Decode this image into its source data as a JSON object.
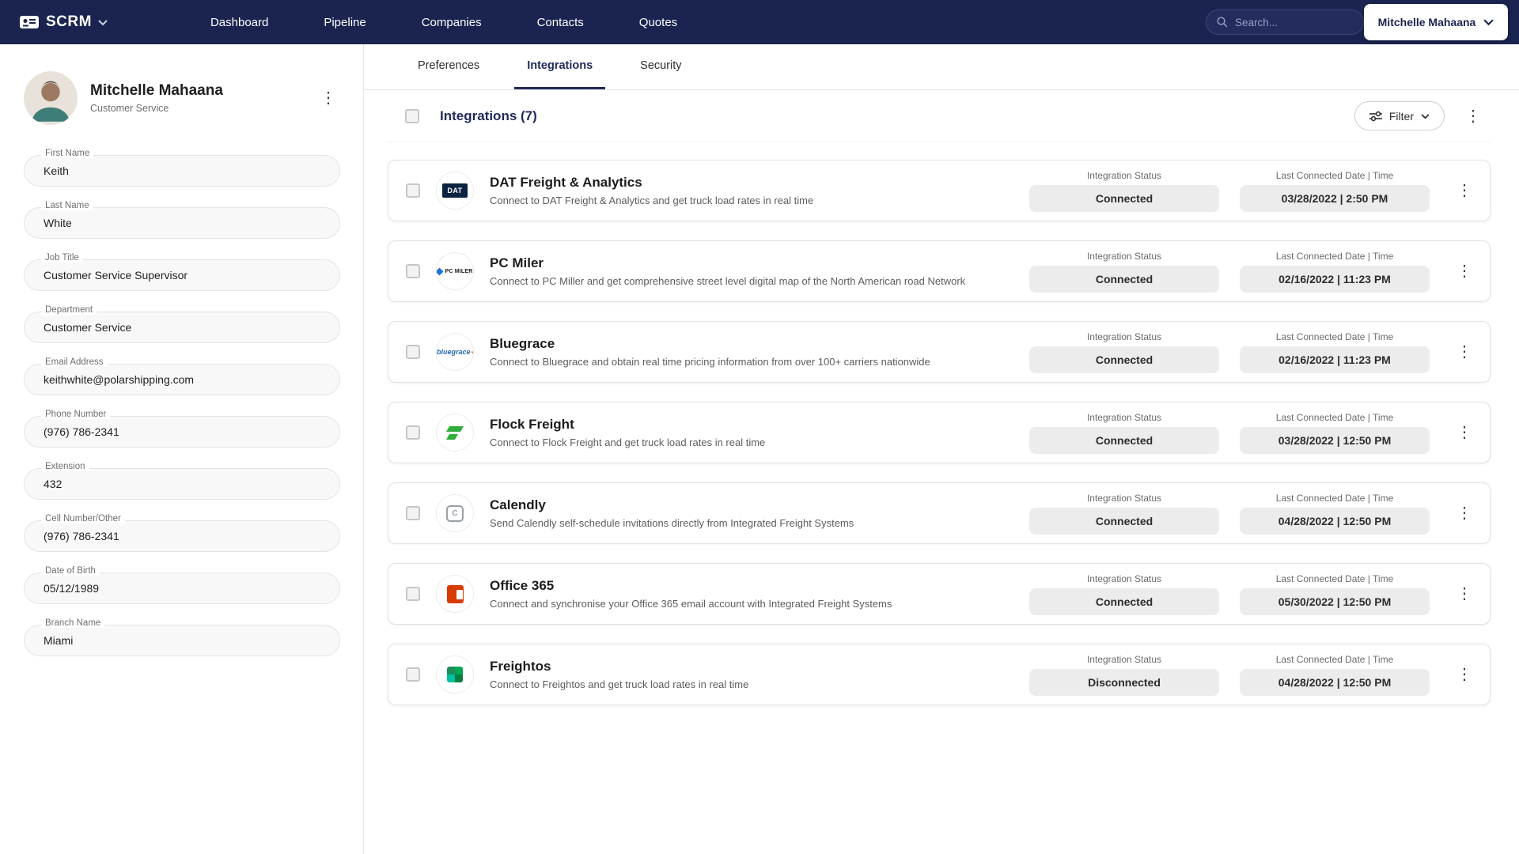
{
  "colors": {
    "navbar": "#1b2450",
    "accent": "#1e2a5a",
    "pill_bg": "#ececec"
  },
  "navbar": {
    "brand": "SCRM",
    "items": [
      {
        "label": "Dashboard"
      },
      {
        "label": "Pipeline"
      },
      {
        "label": "Companies"
      },
      {
        "label": "Contacts"
      },
      {
        "label": "Quotes"
      }
    ],
    "search_placeholder": "Search...",
    "user": "Mitchelle Mahaana"
  },
  "profile": {
    "name": "Mitchelle Mahaana",
    "role": "Customer Service",
    "fields": [
      {
        "label": "First Name",
        "value": "Keith"
      },
      {
        "label": "Last Name",
        "value": "White"
      },
      {
        "label": "Job Title",
        "value": "Customer Service Supervisor"
      },
      {
        "label": "Department",
        "value": "Customer Service"
      },
      {
        "label": "Email Address",
        "value": "keithwhite@polarshipping.com"
      },
      {
        "label": "Phone Number",
        "value": "(976) 786-2341"
      },
      {
        "label": "Extension",
        "value": "432"
      },
      {
        "label": "Cell Number/Other",
        "value": "(976) 786-2341"
      },
      {
        "label": "Date of Birth",
        "value": "05/12/1989"
      },
      {
        "label": "Branch Name",
        "value": "Miami"
      }
    ]
  },
  "tabs": [
    {
      "label": "Preferences",
      "active": false
    },
    {
      "label": "Integrations",
      "active": true
    },
    {
      "label": "Security",
      "active": false
    }
  ],
  "integrations": {
    "title": "Integrations (7)",
    "filter_label": "Filter",
    "status_label": "Integration Status",
    "date_label": "Last Connected Date | Time",
    "items": [
      {
        "name": "DAT Freight & Analytics",
        "description": "Connect to DAT Freight & Analytics and get truck load rates in real time",
        "status": "Connected",
        "date": "03/28/2022 | 2:50 PM",
        "logo": "dat-logo"
      },
      {
        "name": "PC Miler",
        "description": "Connect to PC Miller and get comprehensive street level digital map of the North American road Network",
        "status": "Connected",
        "date": "02/16/2022 | 11:23 PM",
        "logo": "pcmiler-logo"
      },
      {
        "name": "Bluegrace",
        "description": "Connect to Bluegrace and obtain real time pricing information from over 100+ carriers nationwide",
        "status": "Connected",
        "date": "02/16/2022 | 11:23 PM",
        "logo": "bluegrace-logo"
      },
      {
        "name": "Flock Freight",
        "description": "Connect to Flock Freight and get truck load rates in real time",
        "status": "Connected",
        "date": "03/28/2022 | 12:50 PM",
        "logo": "flockfreight-logo"
      },
      {
        "name": "Calendly",
        "description": "Send Calendly self-schedule invitations directly from Integrated Freight Systems",
        "status": "Connected",
        "date": "04/28/2022 | 12:50 PM",
        "logo": "calendly-logo"
      },
      {
        "name": "Office 365",
        "description": "Connect and synchronise your Office 365 email account with Integrated Freight Systems",
        "status": "Connected",
        "date": "05/30/2022 | 12:50 PM",
        "logo": "office365-logo"
      },
      {
        "name": "Freightos",
        "description": "Connect to Freightos and get truck load rates in real time",
        "status": "Disconnected",
        "date": "04/28/2022 | 12:50 PM",
        "logo": "freightos-logo"
      }
    ]
  }
}
